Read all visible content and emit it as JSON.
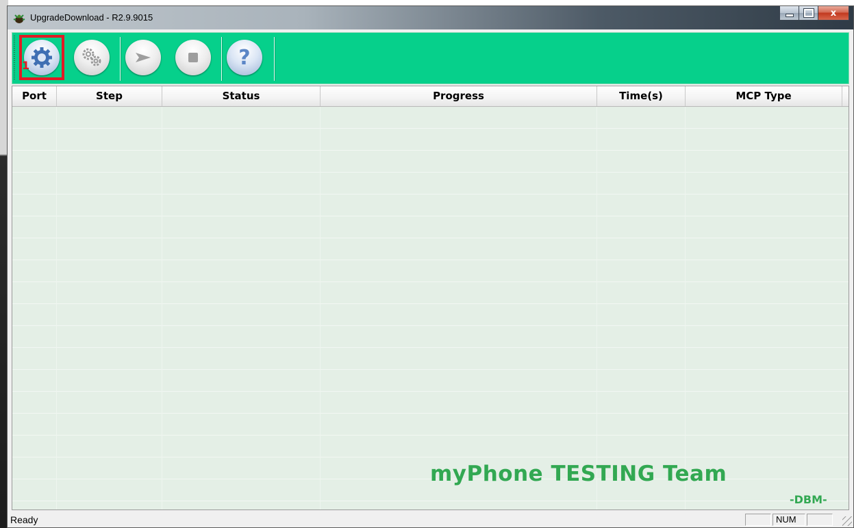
{
  "window": {
    "title": "UpgradeDownload - R2.9.9015",
    "close_glyph": "x"
  },
  "toolbar": {
    "accent_color": "#06d08b",
    "highlight_color": "#e01b24",
    "badge": "1",
    "buttons": [
      {
        "name": "settings-button",
        "icon": "gear-icon"
      },
      {
        "name": "advanced-settings-button",
        "icon": "gears-icon"
      },
      {
        "name": "start-button",
        "icon": "play-icon"
      },
      {
        "name": "stop-button",
        "icon": "stop-icon"
      },
      {
        "name": "help-button",
        "icon": "help-icon",
        "glyph": "?"
      }
    ]
  },
  "table": {
    "columns": [
      "Port",
      "Step",
      "Status",
      "Progress",
      "Time(s)",
      "MCP Type"
    ],
    "rows": []
  },
  "watermark": {
    "main": "myPhone TESTING Team",
    "sub": "-DBM-"
  },
  "statusbar": {
    "text": "Ready",
    "num": "NUM"
  }
}
